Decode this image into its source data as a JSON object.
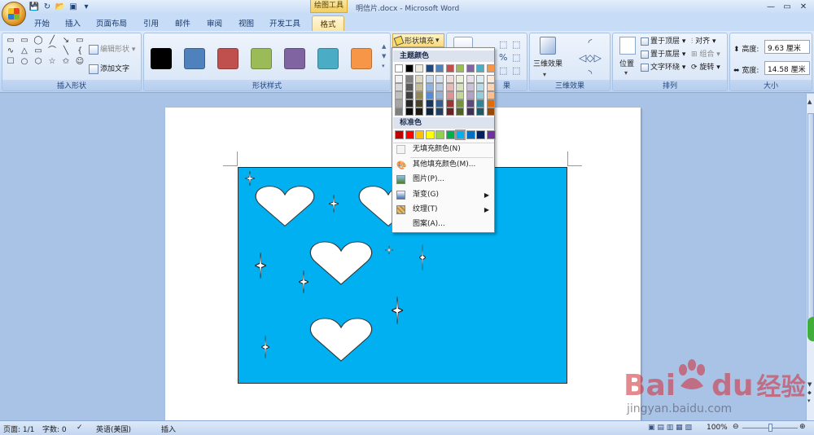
{
  "window": {
    "title": "明信片.docx - Microsoft Word",
    "context_tab": "绘图工具"
  },
  "tabs": [
    "开始",
    "插入",
    "页面布局",
    "引用",
    "邮件",
    "审阅",
    "视图",
    "开发工具",
    "格式"
  ],
  "active_tab": "格式",
  "ribbon": {
    "insert_shapes": {
      "label": "插入形状",
      "edit_shape": "编辑形状",
      "add_text": "添加文字"
    },
    "shape_styles": {
      "label": "形状样式",
      "swatches": [
        "#000000",
        "#4f81bd",
        "#c0504d",
        "#9bbb59",
        "#8064a2",
        "#4bacc6",
        "#f79646"
      ]
    },
    "shape_fill_btn": "形状填充",
    "shadow_effects_label": "果",
    "threed": {
      "btn": "三维效果",
      "label": "三维效果"
    },
    "arrange": {
      "label": "排列",
      "position": "位置",
      "front": "置于顶层",
      "back": "置于底层",
      "wrap": "文字环绕",
      "align": "对齐",
      "group": "组合",
      "rotate": "旋转"
    },
    "size": {
      "label": "大小",
      "height_label": "高度:",
      "height": "9.63 厘米",
      "width_label": "宽度:",
      "width": "14.58 厘米"
    }
  },
  "fill_menu": {
    "theme_header": "主题颜色",
    "theme_colors": [
      [
        "#ffffff",
        "#f2f2f2",
        "#d8d8d8",
        "#bfbfbf",
        "#a5a5a5",
        "#7f7f7f"
      ],
      [
        "#000000",
        "#7f7f7f",
        "#595959",
        "#3f3f3f",
        "#262626",
        "#0c0c0c"
      ],
      [
        "#eeece1",
        "#ddd9c3",
        "#c4bd97",
        "#938953",
        "#494429",
        "#1d1b10"
      ],
      [
        "#1f497d",
        "#c6d9f0",
        "#8db3e2",
        "#548dd4",
        "#17365d",
        "#0f243e"
      ],
      [
        "#4f81bd",
        "#dbe5f1",
        "#b8cce4",
        "#95b3d7",
        "#366092",
        "#244061"
      ],
      [
        "#c0504d",
        "#f2dcdb",
        "#e5b9b7",
        "#d99694",
        "#953734",
        "#632423"
      ],
      [
        "#9bbb59",
        "#ebf1dd",
        "#d7e3bc",
        "#c3d69b",
        "#76923c",
        "#4f6128"
      ],
      [
        "#8064a2",
        "#e5e0ec",
        "#ccc1d9",
        "#b2a2c7",
        "#5f497a",
        "#3f3151"
      ],
      [
        "#4bacc6",
        "#dbeef3",
        "#b7dde8",
        "#92cddc",
        "#31859b",
        "#205867"
      ],
      [
        "#f79646",
        "#fdeada",
        "#fbd5b5",
        "#fac08f",
        "#e36c09",
        "#974806"
      ]
    ],
    "std_header": "标准色",
    "std_colors": [
      "#c00000",
      "#ff0000",
      "#ffc000",
      "#ffff00",
      "#92d050",
      "#00b050",
      "#00b0f0",
      "#0070c0",
      "#002060",
      "#7030a0"
    ],
    "items": [
      {
        "label": "无填充颜色(N)",
        "arrow": ""
      },
      {
        "label": "其他填充颜色(M)...",
        "arrow": ""
      },
      {
        "label": "图片(P)...",
        "arrow": ""
      },
      {
        "label": "渐变(G)",
        "arrow": "▶"
      },
      {
        "label": "纹理(T)",
        "arrow": "▶"
      },
      {
        "label": "图案(A)...",
        "arrow": ""
      }
    ]
  },
  "status": {
    "page": "页面: 1/1",
    "words": "字数: 0",
    "lang": "英语(美国)",
    "mode": "插入",
    "zoom": "100%"
  },
  "watermark": {
    "brand": "Bai",
    "brand2": "du",
    "brand3": "经验",
    "url": "jingyan.baidu.com"
  },
  "canvas_color": "#00b0f0"
}
